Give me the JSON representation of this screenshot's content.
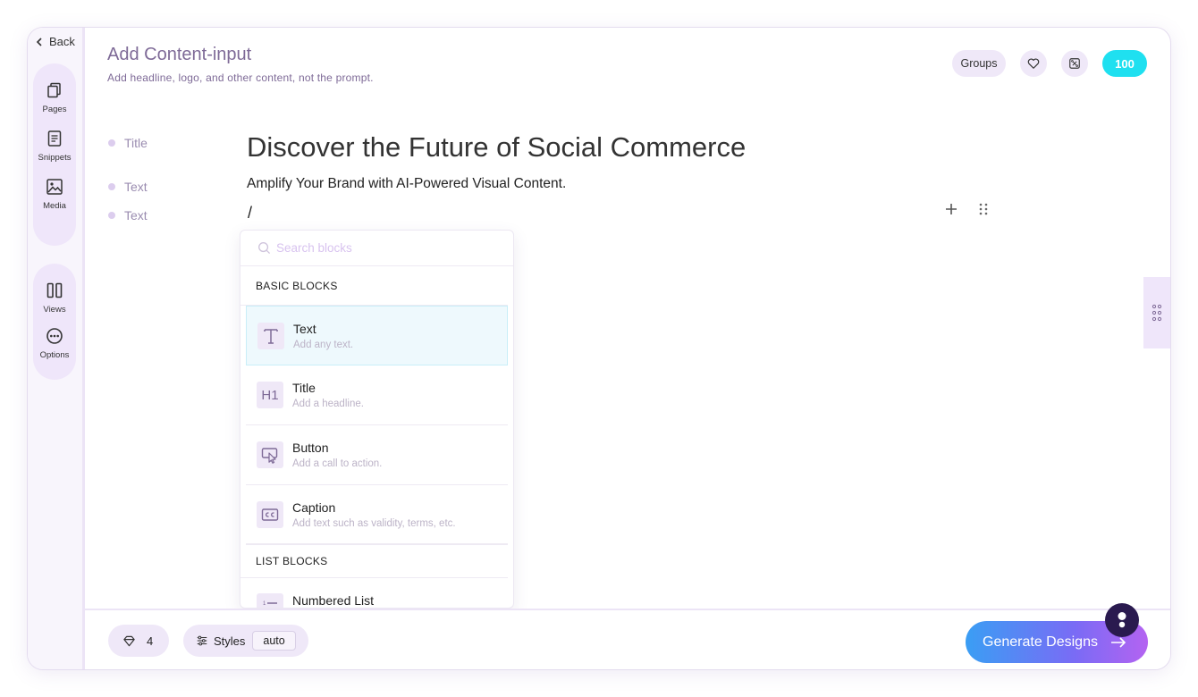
{
  "sidebar": {
    "back_label": "Back",
    "items": [
      {
        "label": "Pages"
      },
      {
        "label": "Snippets"
      },
      {
        "label": "Media"
      },
      {
        "label": "Views"
      },
      {
        "label": "Options"
      }
    ]
  },
  "header": {
    "title": "Add Content-input",
    "subtitle": "Add headline, logo, and other content, not the prompt.",
    "groups_label": "Groups",
    "credits": "100"
  },
  "outline": [
    "Title",
    "Text",
    "Text"
  ],
  "document": {
    "title": "Discover the Future of Social Commerce",
    "text": "Amplify Your Brand with AI-Powered Visual Content.",
    "slash": "/"
  },
  "dropdown": {
    "search_placeholder": "Search blocks",
    "basic_label": "BASIC BLOCKS",
    "basic_blocks": [
      {
        "name": "Text",
        "desc": "Add any text.",
        "icon": "text-icon"
      },
      {
        "name": "Title",
        "desc": "Add a headline.",
        "icon": "h1-icon",
        "icon_text": "H1"
      },
      {
        "name": "Button",
        "desc": "Add a call to action.",
        "icon": "button-cursor-icon"
      },
      {
        "name": "Caption",
        "desc": "Add text such as validity, terms, etc.",
        "icon": "cc-icon"
      }
    ],
    "list_label": "LIST BLOCKS",
    "list_blocks": [
      {
        "name": "Numbered List",
        "icon": "numbered-list-icon"
      }
    ]
  },
  "footer": {
    "gem_count": "4",
    "styles_label": "Styles",
    "styles_value": "auto",
    "generate_label": "Generate Designs"
  },
  "colors": {
    "accent": "#7e6a97",
    "credits_bg": "#1fe0f0",
    "sidebar_pill": "#efe6fa"
  }
}
